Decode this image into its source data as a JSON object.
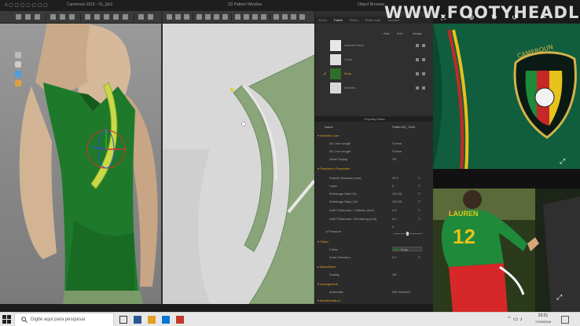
{
  "watermark": "WWW.FOOTYHEADLINES.COM",
  "app": {
    "window_3d_title": "Cameroon 2015 - 01_2pt1",
    "window_2d_title": "2D Pattern Window",
    "object_browser_title": "Object Browser",
    "object_browser": {
      "tabs": [
        "Scene",
        "Fabric",
        "Button",
        "Buttonhole",
        "Topstitch"
      ],
      "active_tab": "Fabric",
      "actions": {
        "add": "+ Add",
        "sort": "Sort",
        "assign": "Assign"
      },
      "fabrics": [
        {
          "name": "Default Fabric",
          "color": "#e8e8e8",
          "selected": false
        },
        {
          "name": "Collar",
          "color": "#dedede",
          "selected": false
        },
        {
          "name": "Body",
          "color": "#2f6e2a",
          "selected": true
        },
        {
          "name": "Sleeves",
          "color": "#d8d8d8",
          "selected": false
        }
      ]
    },
    "property_editor": {
      "title": "Property Editor",
      "header": {
        "name_label": "Name",
        "name_value": "Pattern2D_1168"
      },
      "sections": [
        {
          "type": "section",
          "label": "Selected Line"
        },
        {
          "type": "row",
          "label": "2D Line Length",
          "value": "0.0mm"
        },
        {
          "type": "row",
          "label": "3D Line Length",
          "value": "0.0mm"
        },
        {
          "type": "row",
          "label": "Seam Taping",
          "value": "Off"
        },
        {
          "type": "section",
          "label": "Simulation Properties"
        },
        {
          "type": "row",
          "label": "Particle Distance (mm)",
          "value": "20.0"
        },
        {
          "type": "row",
          "label": "Layer",
          "value": "0"
        },
        {
          "type": "row",
          "label": "Shrinkage Weft (%)",
          "value": "100.00"
        },
        {
          "type": "row",
          "label": "Shrinkage Warp (%)",
          "value": "100.00"
        },
        {
          "type": "row",
          "label": "Add'l Thickness - Collision (mm)",
          "value": "2.5"
        },
        {
          "type": "row",
          "label": "Add'l Thickness - Rendering (mm)",
          "value": "0.0"
        },
        {
          "type": "row",
          "label": "Pressure",
          "value": "0"
        },
        {
          "type": "section",
          "label": "Fabric"
        },
        {
          "type": "row",
          "label": "Fabric",
          "value": "Body"
        },
        {
          "type": "row",
          "label": "Grain Direction",
          "value": "0.0"
        },
        {
          "type": "section",
          "label": "Bond/Skive"
        },
        {
          "type": "row",
          "label": "Solidify",
          "value": "Off"
        },
        {
          "type": "section",
          "label": "Arrangement"
        },
        {
          "type": "row",
          "label": "Automatic",
          "value": "Not Selected"
        },
        {
          "type": "section",
          "label": "MoreDetails.ui"
        }
      ]
    }
  },
  "taskbar": {
    "search_placeholder": "Digite aqui para pesquisar",
    "time": "23:21",
    "date": "17/04/2018"
  },
  "photo": {
    "player_name": "LAUREN",
    "player_number": "12"
  },
  "colors": {
    "shirt_green": "#1e7a2a",
    "pattern_green": "#8aa57a",
    "accent": "#e0a020"
  }
}
